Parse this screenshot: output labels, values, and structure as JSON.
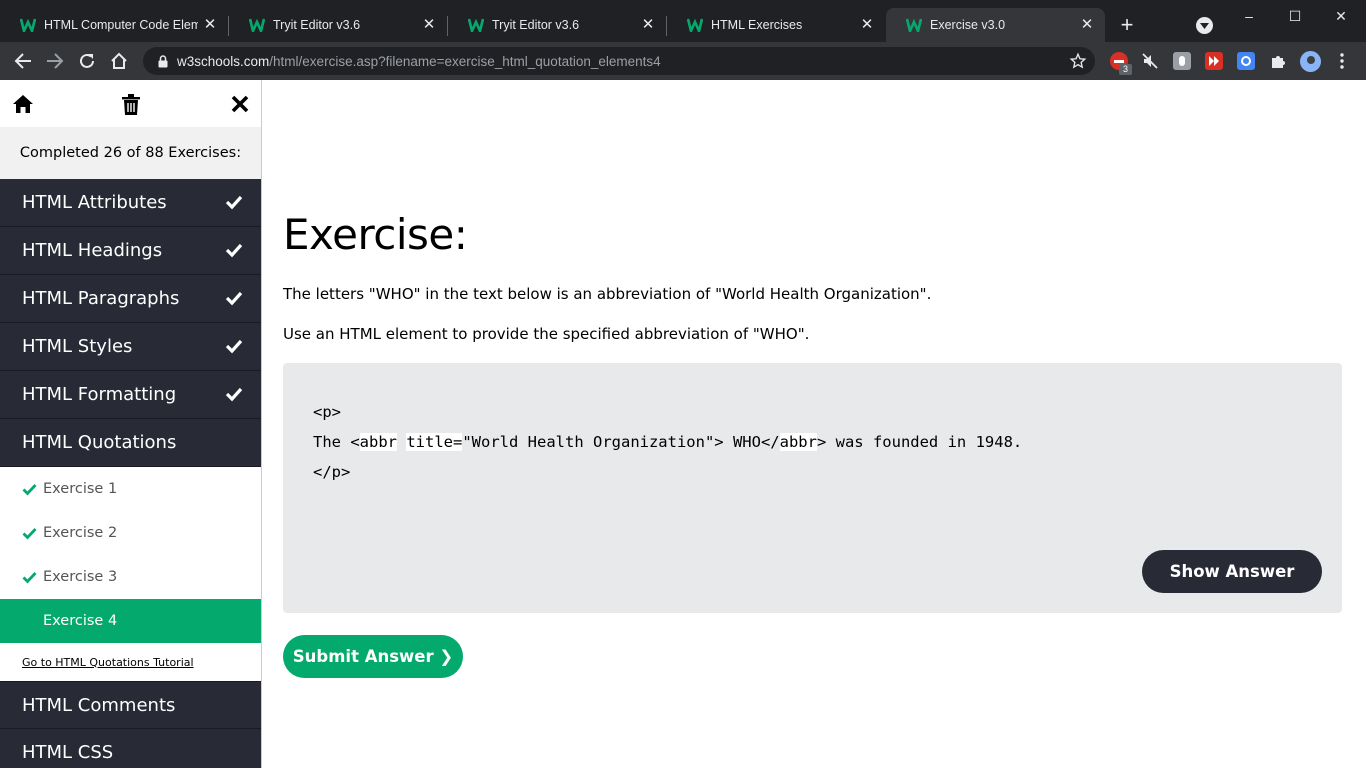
{
  "browser": {
    "tabs": [
      {
        "title": "HTML Computer Code Eleme",
        "active": false
      },
      {
        "title": "Tryit Editor v3.6",
        "active": false
      },
      {
        "title": "Tryit Editor v3.6",
        "active": false
      },
      {
        "title": "HTML Exercises",
        "active": false
      },
      {
        "title": "Exercise v3.0",
        "active": true
      }
    ],
    "url_host": "w3schools.com",
    "url_path": "/html/exercise.asp?filename=exercise_html_quotation_elements4",
    "extension_badge": "3",
    "window_controls": {
      "minimize": "–",
      "maximize": "☐",
      "close": "✕"
    },
    "new_tab": "+"
  },
  "sidebar": {
    "completed_text": "Completed 26 of 88 Exercises:",
    "items_before": [
      {
        "label": "HTML Attributes",
        "done": true
      },
      {
        "label": "HTML Headings",
        "done": true
      },
      {
        "label": "HTML Paragraphs",
        "done": true
      },
      {
        "label": "HTML Styles",
        "done": true
      },
      {
        "label": "HTML Formatting",
        "done": true
      },
      {
        "label": "HTML Quotations",
        "done": false
      }
    ],
    "sub_items": [
      {
        "label": "Exercise 1",
        "done": true
      },
      {
        "label": "Exercise 2",
        "done": true
      },
      {
        "label": "Exercise 3",
        "done": true
      },
      {
        "label": "Exercise 4",
        "done": false,
        "current": true
      }
    ],
    "tutorial_link": "Go to HTML Quotations Tutorial",
    "items_after": [
      {
        "label": "HTML Comments"
      },
      {
        "label": "HTML CSS"
      }
    ]
  },
  "exercise": {
    "title": "Exercise:",
    "instruction_1": "The letters \"WHO\" in the text below is an abbreviation of \"World Health Organization\".",
    "instruction_2": "Use an HTML element to provide the specified abbreviation of \"WHO\".",
    "code": {
      "line1": "<p>",
      "line2_prefix": "The <",
      "input1": "abbr",
      "space": " ",
      "input2": "title=",
      "line2_middle": "\"World Health Organization\"> WHO</",
      "input3": "abbr",
      "line2_suffix": "> was founded in 1948.",
      "line3": "</p>"
    },
    "show_answer_label": "Show Answer",
    "submit_label": "Submit Answer ❯"
  },
  "colors": {
    "accent_green": "#04AA6D",
    "sidebar_dark": "#282A35",
    "code_bg": "#E7E9EB"
  }
}
